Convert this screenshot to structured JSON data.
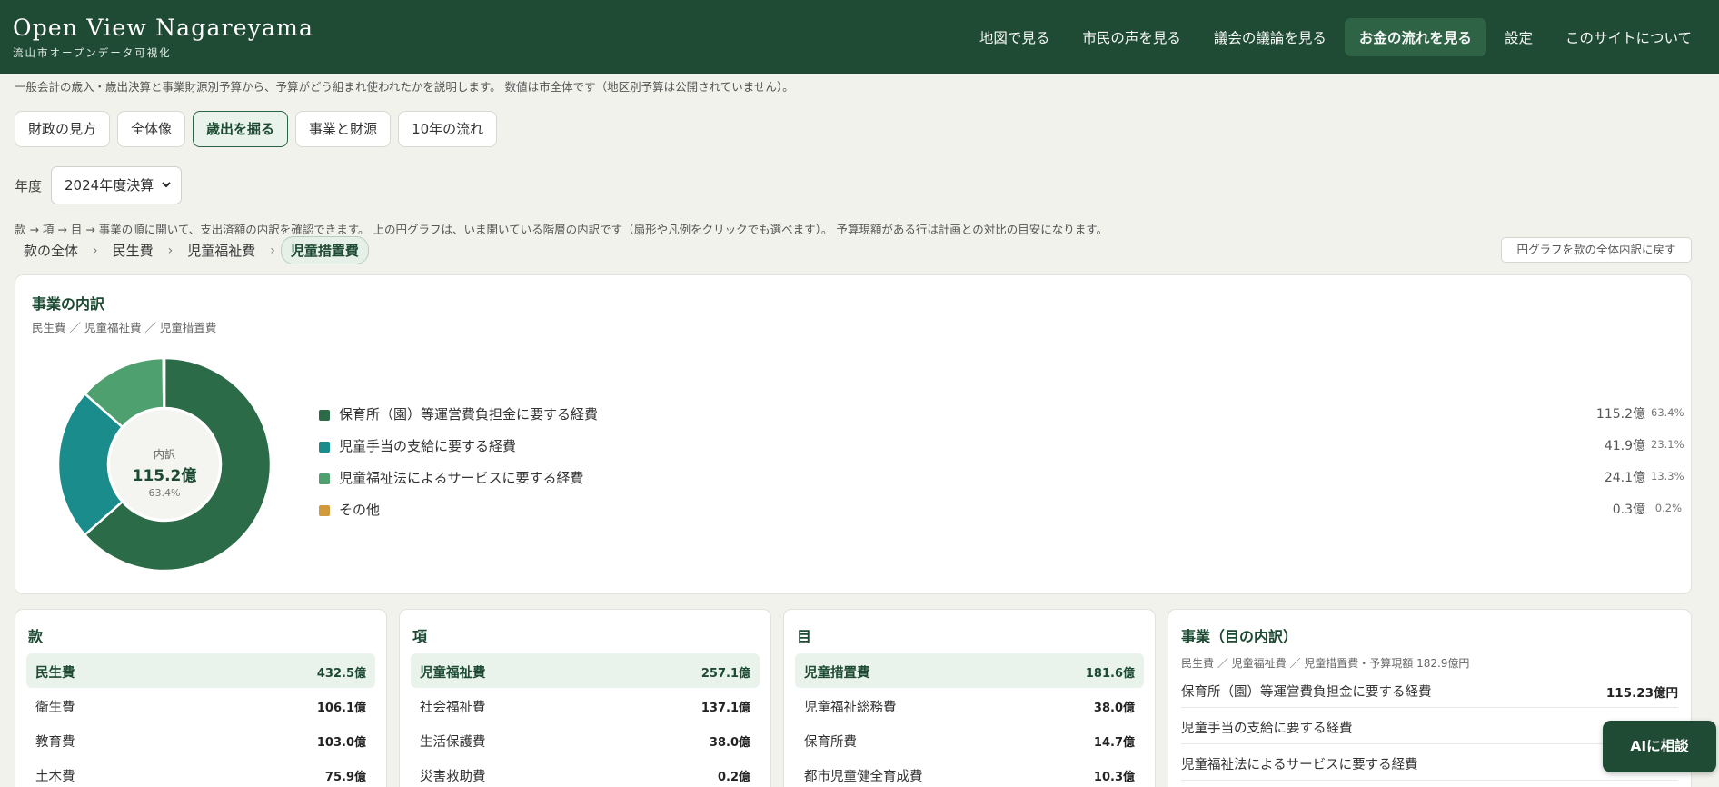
{
  "header": {
    "title": "Open View Nagareyama",
    "subtitle": "流山市オープンデータ可視化",
    "nav": [
      {
        "label": "地図で見る",
        "active": false
      },
      {
        "label": "市民の声を見る",
        "active": false
      },
      {
        "label": "議会の議論を見る",
        "active": false
      },
      {
        "label": "お金の流れを見る",
        "active": true
      },
      {
        "label": "設定",
        "active": false
      },
      {
        "label": "このサイトについて",
        "active": false
      }
    ]
  },
  "intro": "一般会計の歳入・歳出決算と事業財源別予算から、予算がどう組まれ使われたかを説明します。 数値は市全体です（地区別予算は公開されていません）。",
  "tabs": [
    {
      "label": "財政の見方",
      "active": false
    },
    {
      "label": "全体像",
      "active": false
    },
    {
      "label": "歳出を掘る",
      "active": true
    },
    {
      "label": "事業と財源",
      "active": false
    },
    {
      "label": "10年の流れ",
      "active": false
    }
  ],
  "year": {
    "label": "年度",
    "value": "2024年度決算"
  },
  "help": "款 → 項 → 目 → 事業の順に開いて、支出済額の内訳を確認できます。 上の円グラフは、いま開いている階層の内訳です（扇形や凡例をクリックでも選べます）。 予算現額がある行は計画との対比の目安になります。",
  "breadcrumb": {
    "items": [
      "款の全体",
      "民生費",
      "児童福祉費",
      "児童措置費"
    ],
    "separator": "›",
    "reset_label": "円グラフを款の全体内訳に戻す"
  },
  "breakdown": {
    "title": "事業の内訳",
    "path": "民生費 ／ 児童福祉費 ／ 児童措置費",
    "center": {
      "label": "内訳",
      "value": "115.2億",
      "pct": "63.4%"
    }
  },
  "chart_data": {
    "type": "pie",
    "categories": [
      "保育所（園）等運営費負担金に要する経費",
      "児童手当の支給に要する経費",
      "児童福祉法によるサービスに要する経費",
      "その他"
    ],
    "values": [
      115.2,
      41.9,
      24.1,
      0.3
    ],
    "value_labels": [
      "115.2億",
      "41.9億",
      "24.1億",
      "0.3億"
    ],
    "percent_labels": [
      "63.4%",
      "23.1%",
      "13.3%",
      "0.2%"
    ],
    "colors": [
      "#2c6b47",
      "#1a8c8b",
      "#4ea06e",
      "#d09a3a"
    ]
  },
  "columns": {
    "kan": {
      "title": "款",
      "rows": [
        {
          "label": "民生費",
          "value": "432.5億",
          "selected": true
        },
        {
          "label": "衛生費",
          "value": "106.1億"
        },
        {
          "label": "教育費",
          "value": "103.0億"
        },
        {
          "label": "土木費",
          "value": "75.9億"
        }
      ]
    },
    "kou": {
      "title": "項",
      "rows": [
        {
          "label": "児童福祉費",
          "value": "257.1億",
          "selected": true
        },
        {
          "label": "社会福祉費",
          "value": "137.1億"
        },
        {
          "label": "生活保護費",
          "value": "38.0億"
        },
        {
          "label": "災害救助費",
          "value": "0.2億"
        }
      ]
    },
    "moku": {
      "title": "目",
      "rows": [
        {
          "label": "児童措置費",
          "value": "181.6億",
          "selected": true
        },
        {
          "label": "児童福祉総務費",
          "value": "38.0億"
        },
        {
          "label": "保育所費",
          "value": "14.7億"
        },
        {
          "label": "都市児童健全育成費",
          "value": "10.3億"
        }
      ]
    },
    "project": {
      "title": "事業（目の内訳）",
      "path": "民生費 ／ 児童福祉費 ／ 児童措置費・予算現額 182.9億円",
      "rows": [
        {
          "label": "保育所（園）等運営費負担金に要する経費",
          "value": "115.23億円"
        },
        {
          "label": "児童手当の支給に要する経費",
          "value": ""
        },
        {
          "label": "児童福祉法によるサービスに要する経費",
          "value": ""
        }
      ]
    }
  },
  "ai_button": "AIに相談"
}
